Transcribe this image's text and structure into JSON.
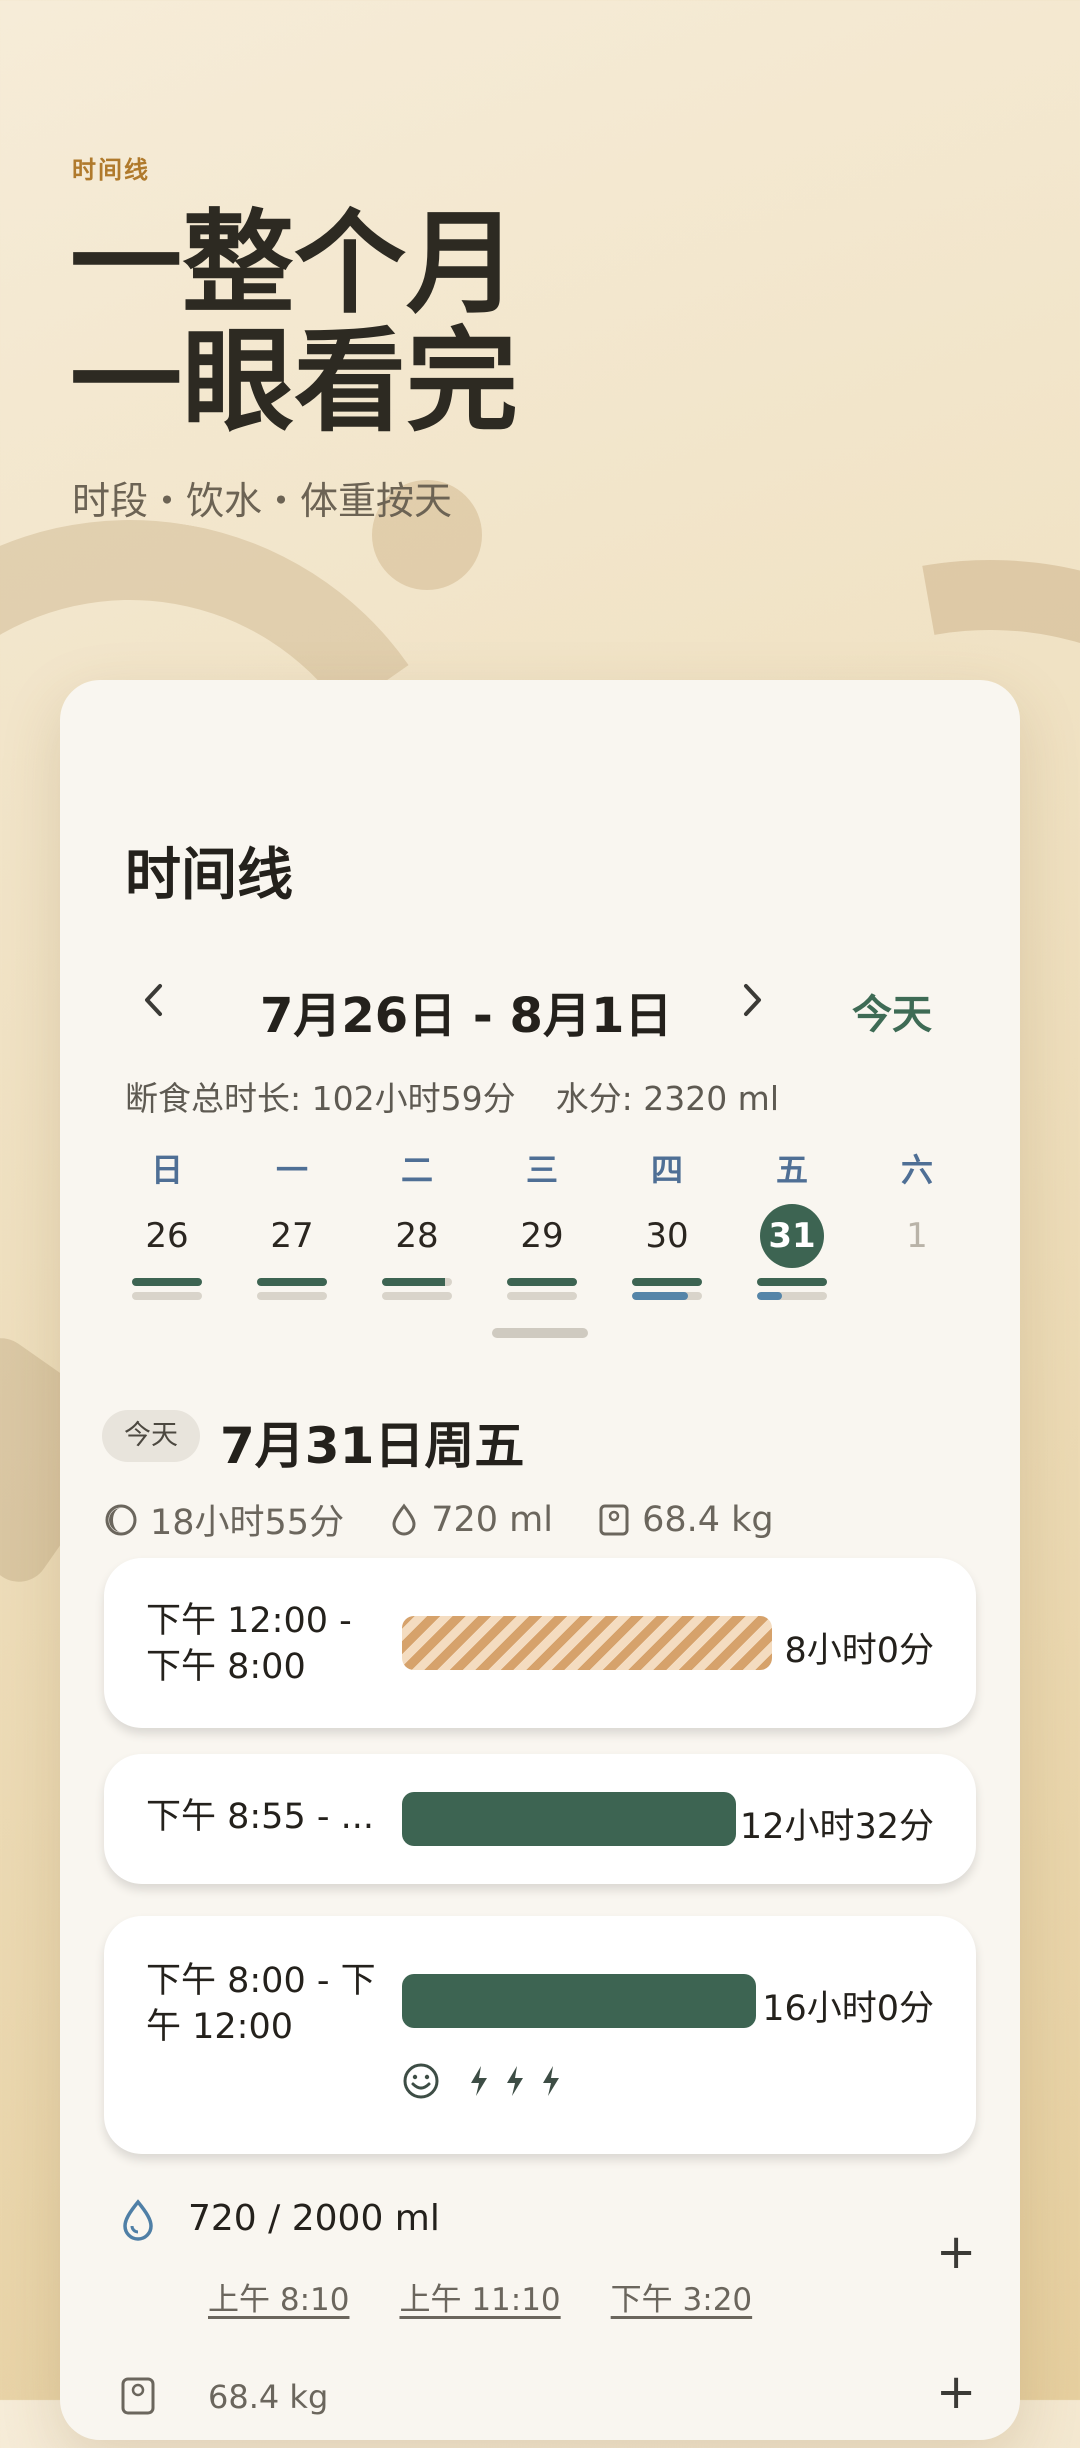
{
  "marketing": {
    "eyebrow": "时间线",
    "headline_line1": "一整个月",
    "headline_line2": "一眼看完",
    "subtitle": "时段・饮水・体重按天"
  },
  "card": {
    "title": "时间线",
    "range": "7月26日 - 8月1日",
    "prev_icon": "‹",
    "next_icon": "›",
    "today_button": "今天",
    "summary_fast": "断食总时长: 102小时59分",
    "summary_water": "水分:  2320 ml",
    "week": [
      {
        "wd": "日",
        "num": "26",
        "fast": 1.0,
        "water": 0
      },
      {
        "wd": "一",
        "num": "27",
        "fast": 1.0,
        "water": 0
      },
      {
        "wd": "二",
        "num": "28",
        "fast": 0.9,
        "water": 0
      },
      {
        "wd": "三",
        "num": "29",
        "fast": 1.0,
        "water": 0
      },
      {
        "wd": "四",
        "num": "30",
        "fast": 1.0,
        "water": 0.8
      },
      {
        "wd": "五",
        "num": "31",
        "fast": 1.0,
        "water": 0.36,
        "selected": true
      },
      {
        "wd": "六",
        "num": "1",
        "future": true
      }
    ]
  },
  "day": {
    "badge": "今天",
    "title": "7月31日周五",
    "stat_fast": "18小时55分",
    "stat_water": "720 ml",
    "stat_weight": "68.4 kg",
    "fasts": [
      {
        "time": "下午 12:00 -\n下午 8:00",
        "duration": "8小时0分",
        "style": "striped",
        "fill": 1.0
      },
      {
        "time": "下午 8:55 - ...",
        "duration": "12小时32分",
        "style": "solid",
        "fill": 0.92
      },
      {
        "time": "下午 8:00 - 下\n午 12:00",
        "duration": "16小时0分",
        "style": "solid",
        "fill": 0.98,
        "mood_icon": "smile-icon",
        "energy_icons": 3
      }
    ],
    "water": {
      "amount": "720 / 2000 ml",
      "times": [
        "上午 8:10",
        "上午 11:10",
        "下午 3:20"
      ],
      "plus": "+"
    },
    "weight": {
      "value": "68.4 kg",
      "plus": "+"
    }
  },
  "colors": {
    "accent_green": "#3d6452",
    "water_blue": "#5585a8",
    "eyebrow_orange": "#b07a2c"
  }
}
